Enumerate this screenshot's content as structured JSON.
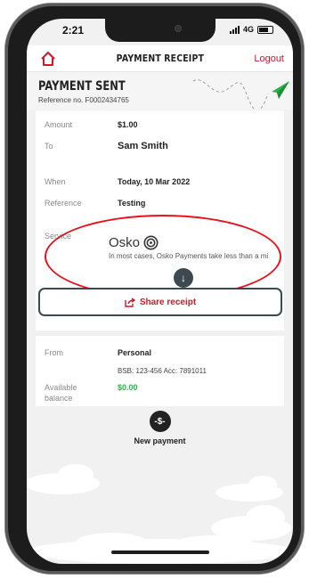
{
  "status_bar": {
    "time": "2:21",
    "network": "4G"
  },
  "nav": {
    "title": "PAYMENT RECEIPT",
    "logout": "Logout"
  },
  "receipt": {
    "title": "PAYMENT SENT",
    "reference_no": "Reference no. F0002434765",
    "rows": {
      "amount": {
        "label": "Amount",
        "value": "$1.00"
      },
      "to": {
        "label": "To",
        "value": "Sam Smith"
      },
      "when": {
        "label": "When",
        "value": "Today, 10 Mar 2022"
      },
      "reference": {
        "label": "Reference",
        "value": "Testing"
      },
      "service": {
        "label": "Service",
        "value": "Osko",
        "note": "In most cases, Osko Payments take less than a mi"
      }
    },
    "share_label": "Share receipt"
  },
  "from_card": {
    "from_label": "From",
    "from_value": "Personal",
    "bsb": "BSB: 123-456 Acc: 7891011",
    "balance_label_1": "Available",
    "balance_label_2": "balance",
    "balance_value": "$0.00"
  },
  "new_payment": {
    "icon_text": "-$-",
    "label": "New payment"
  },
  "colors": {
    "brand_red": "#d3172a",
    "accent_green": "#2bb34a",
    "annotation_red": "#e8121d",
    "annotation_dark": "#3a4a50"
  },
  "icons": [
    "home-icon",
    "paper-plane-icon",
    "osko-icon",
    "download-arrow-icon",
    "share-icon",
    "new-payment-icon"
  ]
}
